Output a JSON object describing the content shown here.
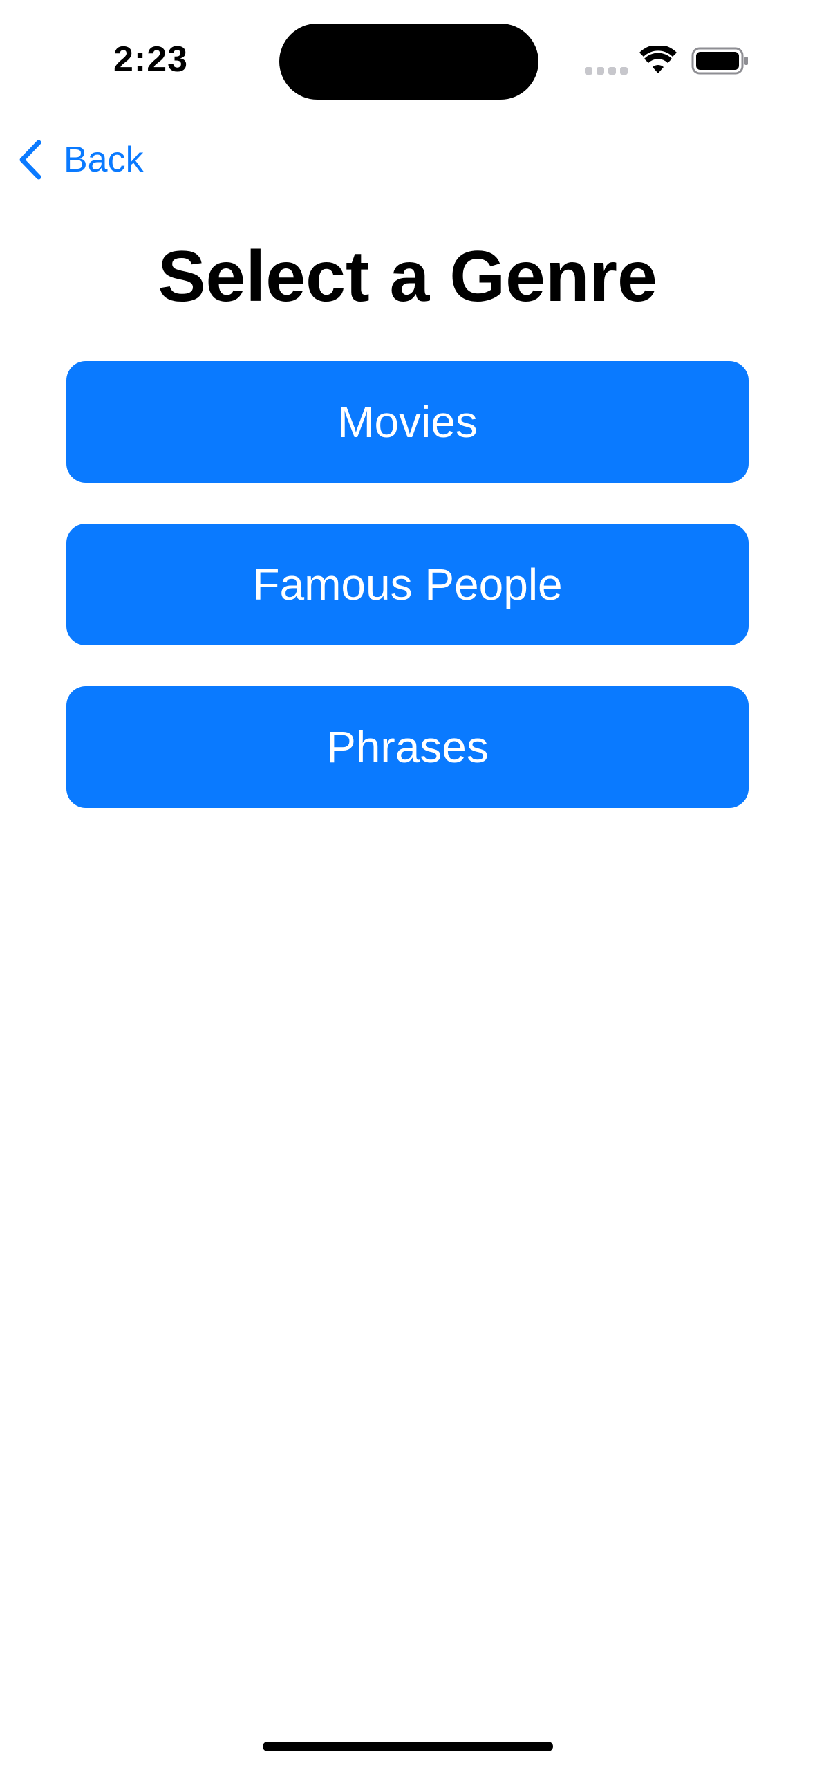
{
  "status_bar": {
    "time": "2:23",
    "icons": [
      "signal-icon",
      "wifi-icon",
      "battery-icon"
    ]
  },
  "nav": {
    "back_label": "Back",
    "back_icon": "chevron-left-icon"
  },
  "title": "Select a Genre",
  "genres": [
    {
      "label": "Movies"
    },
    {
      "label": "Famous People"
    },
    {
      "label": "Phrases"
    }
  ],
  "colors": {
    "accent": "#0a7aff",
    "background": "#ffffff",
    "button_text": "#ffffff",
    "title_text": "#000000"
  }
}
